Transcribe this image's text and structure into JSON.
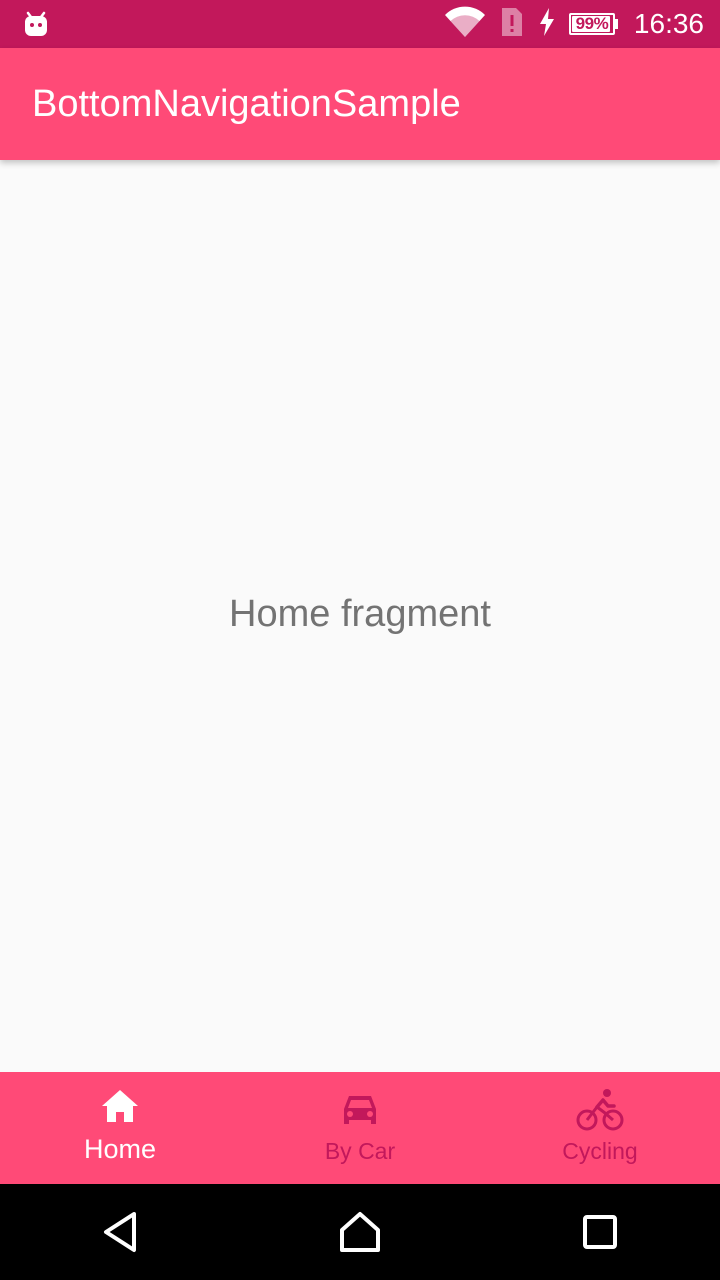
{
  "status_bar": {
    "time": "16:36",
    "battery_percent": "99%",
    "icons": [
      "android-notification-icon",
      "wifi-icon",
      "sim-alert-icon",
      "charging-icon",
      "battery-icon"
    ]
  },
  "app_bar": {
    "title": "BottomNavigationSample"
  },
  "content": {
    "text": "Home fragment"
  },
  "bottom_nav": {
    "items": [
      {
        "label": "Home",
        "icon": "home-icon",
        "active": true
      },
      {
        "label": "By Car",
        "icon": "car-icon",
        "active": false
      },
      {
        "label": "Cycling",
        "icon": "bicycle-icon",
        "active": false
      }
    ]
  },
  "system_nav": {
    "buttons": [
      "back-icon",
      "home-nav-icon",
      "recents-icon"
    ]
  },
  "colors": {
    "primary": "#ff4a77",
    "primary_dark": "#c2185b",
    "background": "#fafafa",
    "content_text": "#737373"
  }
}
